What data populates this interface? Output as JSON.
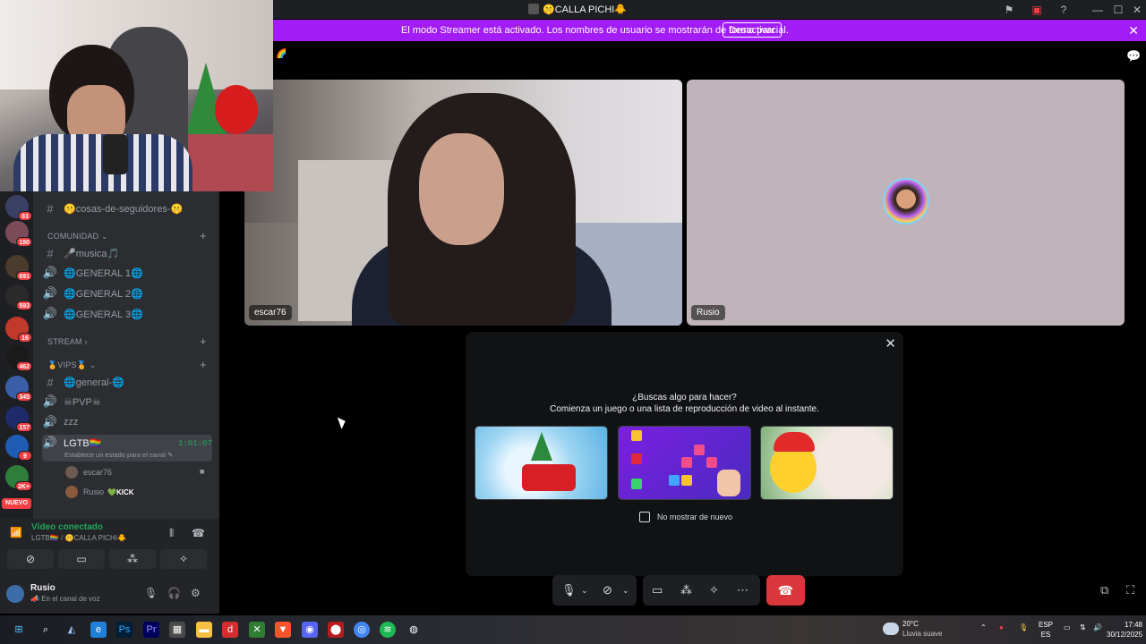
{
  "window": {
    "title": "CALLA PICHI",
    "title_emoji_left": "🤫",
    "title_emoji_right": "🐥"
  },
  "streamer_banner": {
    "text": "El modo Streamer está activado. Los nombres de usuario se mostrarán de forma parcial.",
    "button": "Desactivar",
    "color": "#a21cf5"
  },
  "servers": [
    {
      "badge": "83",
      "color": "#3b3f63"
    },
    {
      "badge": "180",
      "color": "#7a4c5a"
    },
    {
      "badge": "691",
      "color": "#4a3b2c"
    },
    {
      "badge": "593",
      "color": "#2a2a2a"
    },
    {
      "badge": "16",
      "color": "#c0392b"
    },
    {
      "badge": "462",
      "color": "#1a1a1a"
    },
    {
      "badge": "345",
      "color": "#3a5fa8"
    },
    {
      "badge": "157",
      "color": "#1f2a6b"
    },
    {
      "badge": "9",
      "color": "#1e5cb5"
    },
    {
      "badge": "2K+",
      "color": "#2f7d3a"
    }
  ],
  "servers_new_label": "NUEVO",
  "channels": {
    "top_channel": "🤫cosas-de-seguidores-🤫",
    "categories": {
      "comunidad": "COMUNIDAD",
      "stream": "STREAM",
      "vips": "🏅VIPS🏅"
    },
    "comunidad_items": [
      {
        "name": "🎤musica🎵",
        "type": "text"
      },
      {
        "name": "🌐GENERAL 1🌐",
        "type": "voice"
      },
      {
        "name": "🌐GENERAL 2🌐",
        "type": "voice"
      },
      {
        "name": "🌐GENERAL 3🌐",
        "type": "voice"
      }
    ],
    "vips_items": [
      {
        "name": "🌐general-🌐",
        "type": "text"
      },
      {
        "name": "☠PVP☠",
        "type": "voice"
      },
      {
        "name": "zzz",
        "type": "voice"
      }
    ],
    "active_voice": {
      "name": "LGTB🏳️‍🌈",
      "timer": "1:01:07",
      "status": "Establece un estado para el canal"
    },
    "voice_users": [
      {
        "name": "escar76"
      },
      {
        "name": "Rusio",
        "tag": "KICK"
      }
    ]
  },
  "voice_panel": {
    "status": "Vídeo conectado",
    "location": "LGTB🏳️‍🌈 / 🤫CALLA PICHI🐥",
    "user_name": "Rusio",
    "user_status": "En el canal de voz"
  },
  "video_tiles": [
    {
      "name": "escar76"
    },
    {
      "name": "Rusio"
    }
  ],
  "popup": {
    "question": "¿Buscas algo para hacer?",
    "subtitle": "Comienza un juego o una lista de reproducción de video al instante.",
    "checkbox_label": "No mostrar de nuevo",
    "checkbox_checked": false
  },
  "taskbar": {
    "weather_temp": "20°C",
    "weather_desc": "Lluvia suave",
    "lang_top": "ESP",
    "lang_bottom": "ES",
    "time": "17:48",
    "date": "30/12/2025"
  }
}
